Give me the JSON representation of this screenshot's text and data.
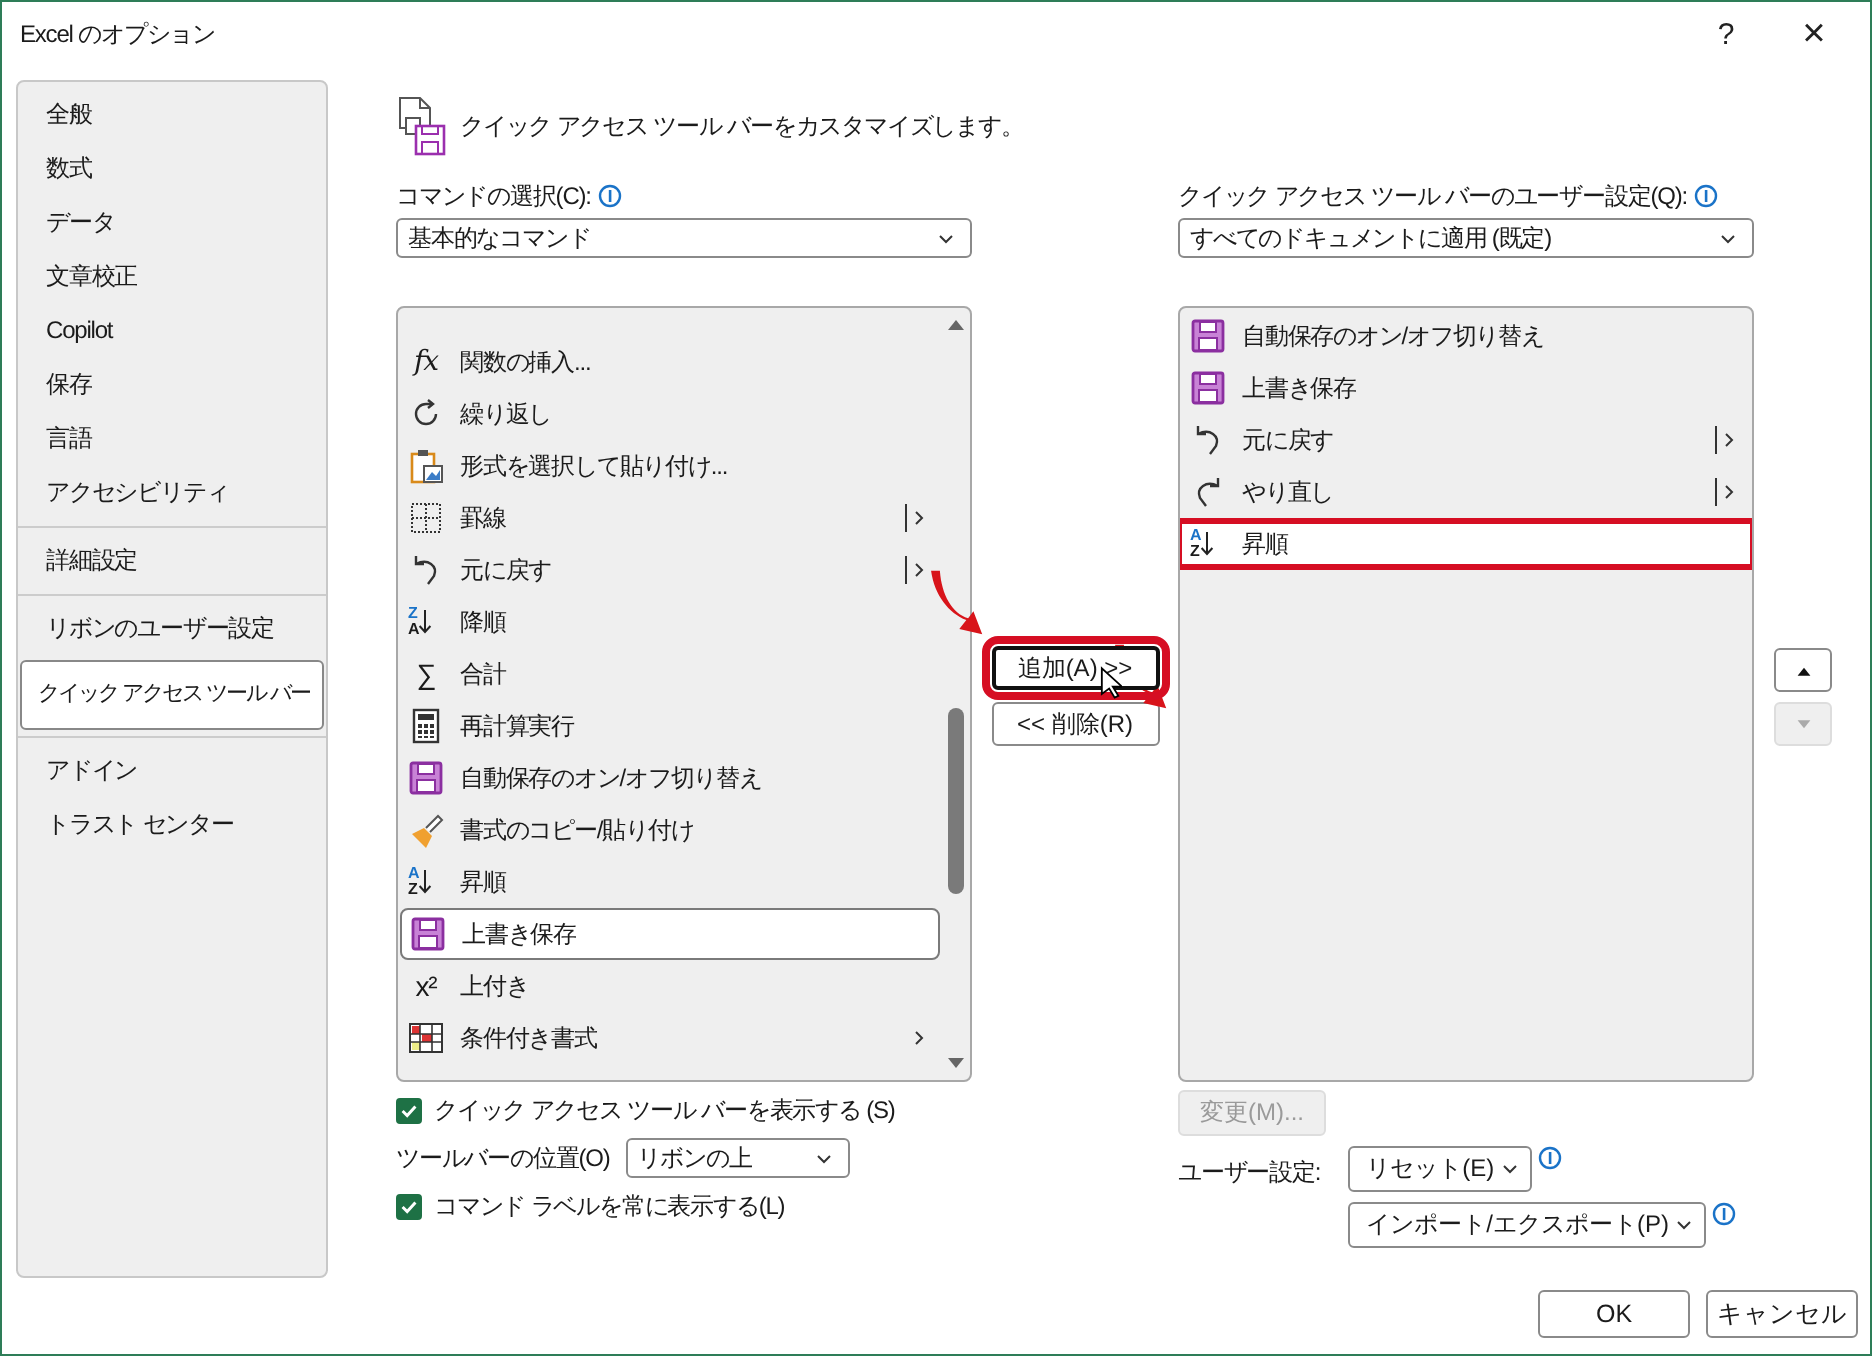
{
  "window": {
    "title": "Excel のオプション",
    "help": "?",
    "close": "×"
  },
  "sidebar": {
    "groups": [
      [
        {
          "label": "全般",
          "selected": false
        },
        {
          "label": "数式",
          "selected": false
        },
        {
          "label": "データ",
          "selected": false
        },
        {
          "label": "文章校正",
          "selected": false
        },
        {
          "label": "Copilot",
          "selected": false
        },
        {
          "label": "保存",
          "selected": false
        },
        {
          "label": "言語",
          "selected": false
        },
        {
          "label": "アクセシビリティ",
          "selected": false
        }
      ],
      [
        {
          "label": "詳細設定",
          "selected": false
        }
      ],
      [
        {
          "label": "リボンのユーザー設定",
          "selected": false
        },
        {
          "label": "クイック アクセス ツール バー",
          "selected": true
        }
      ],
      [
        {
          "label": "アドイン",
          "selected": false
        },
        {
          "label": "トラスト センター",
          "selected": false
        }
      ]
    ]
  },
  "header": "クイック アクセス ツール バーをカスタマイズします。",
  "commands": {
    "label": "コマンドの選択(C):",
    "select": "基本的なコマンド",
    "items": [
      {
        "label": "関数の挿入...",
        "kind": "glyph",
        "glyph": "fx",
        "submenu": false,
        "split": false,
        "selected": false
      },
      {
        "label": "繰り返し",
        "kind": "redo",
        "submenu": false,
        "split": false,
        "selected": false
      },
      {
        "label": "形式を選択して貼り付け...",
        "kind": "paste",
        "submenu": false,
        "split": false,
        "selected": false
      },
      {
        "label": "罫線",
        "kind": "border",
        "submenu": true,
        "split": true,
        "selected": false
      },
      {
        "label": "元に戻す",
        "kind": "undo",
        "submenu": true,
        "split": true,
        "selected": false
      },
      {
        "label": "降順",
        "kind": "sort",
        "glyph": "ZA",
        "submenu": false,
        "split": false,
        "selected": false
      },
      {
        "label": "合計",
        "kind": "glyph",
        "glyph": "∑",
        "submenu": false,
        "split": false,
        "selected": false
      },
      {
        "label": "再計算実行",
        "kind": "calc",
        "submenu": false,
        "split": false,
        "selected": false
      },
      {
        "label": "自動保存のオン/オフ切り替え",
        "kind": "save",
        "submenu": false,
        "split": false,
        "selected": false
      },
      {
        "label": "書式のコピー/貼り付け",
        "kind": "brush",
        "submenu": false,
        "split": false,
        "selected": false
      },
      {
        "label": "昇順",
        "kind": "sort",
        "glyph": "AZ",
        "submenu": false,
        "split": false,
        "selected": false
      },
      {
        "label": "上書き保存",
        "kind": "save",
        "submenu": false,
        "split": false,
        "selected": true
      },
      {
        "label": "上付き",
        "kind": "glyph",
        "glyph": "x²",
        "submenu": false,
        "split": false,
        "selected": false
      },
      {
        "label": "条件付き書式",
        "kind": "condformat",
        "submenu": true,
        "split": false,
        "selected": false
      }
    ],
    "show_qat": {
      "label": "クイック アクセス ツール バーを表示する (S)",
      "checked": true
    },
    "position": {
      "label": "ツールバーの位置(O)",
      "value": "リボンの上"
    },
    "show_labels": {
      "label": "コマンド ラベルを常に表示する(L)",
      "checked": true
    }
  },
  "add_button": {
    "label": "追加(A) >>",
    "highlighted": true
  },
  "remove_button": {
    "label": "<< 削除(R)"
  },
  "toolbar": {
    "label": "クイック アクセス ツール バーのユーザー設定(Q):",
    "select": "すべてのドキュメントに適用 (既定)",
    "items": [
      {
        "label": "自動保存のオン/オフ切り替え",
        "kind": "save",
        "submenu": false,
        "split": false,
        "selected": false
      },
      {
        "label": "上書き保存",
        "kind": "save",
        "submenu": false,
        "split": false,
        "selected": false
      },
      {
        "label": "元に戻す",
        "kind": "undo",
        "submenu": true,
        "split": true,
        "selected": false
      },
      {
        "label": "やり直し",
        "kind": "redo",
        "submenu": true,
        "split": true,
        "selected": false
      },
      {
        "label": "昇順",
        "kind": "sort",
        "glyph": "AZ",
        "submenu": false,
        "split": false,
        "selected": true
      }
    ],
    "modify": {
      "label": "変更(M)...",
      "disabled": true
    },
    "user_settings": "ユーザー設定:",
    "reset": "リセット(E)",
    "import_export": "インポート/エクスポート(P)",
    "move_up": {
      "disabled": false
    },
    "move_down": {
      "disabled": true
    }
  },
  "footer": {
    "ok": "OK",
    "cancel": "キャンセル"
  }
}
